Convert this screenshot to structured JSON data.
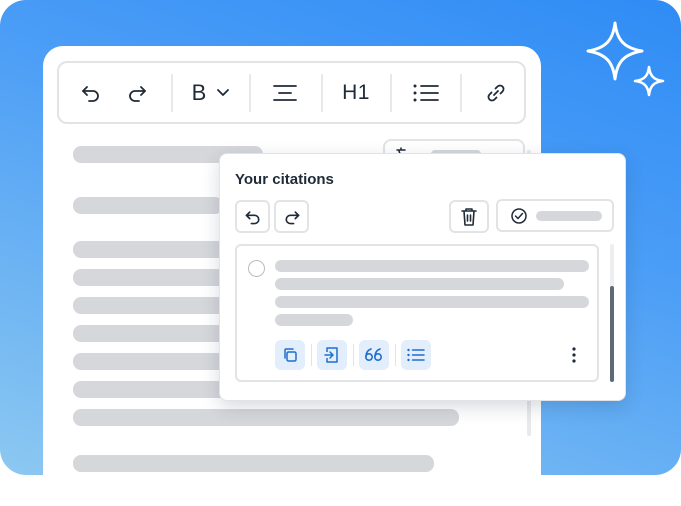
{
  "toolbar": {
    "bold_label": "B",
    "heading_label": "H1"
  },
  "citations_panel": {
    "title": "Your citations"
  },
  "icons": {
    "undo": "undo-icon",
    "redo": "redo-icon",
    "chevron": "chevron-down-icon",
    "align": "align-center-icon",
    "list": "bullet-list-icon",
    "link": "link-icon",
    "trash": "trash-icon",
    "check": "check-circle-icon",
    "copy": "copy-icon",
    "insert": "insert-icon",
    "quote": "quote-icon",
    "more": "more-vertical-icon",
    "sparkle": "sparkle-icon"
  },
  "colors": {
    "background_gradient_top": "#2f8cf5",
    "background_gradient_bottom": "#8cc8f1",
    "accent_light": "#e2eefc",
    "icon_accent": "#1f6fcf",
    "placeholder": "#d5d7da",
    "text_dark": "#1f2b38"
  }
}
